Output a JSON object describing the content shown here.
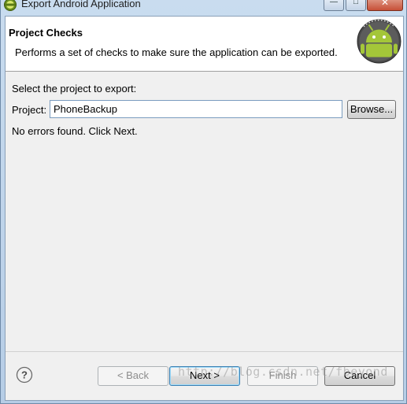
{
  "window": {
    "title": "Export Android Application",
    "app_icon": "eclipse-icon",
    "controls": [
      "minimize-icon",
      "maximize-icon",
      "close-icon"
    ]
  },
  "banner": {
    "title": "Project Checks",
    "description": "Performs a set of checks to make sure the application can be exported.",
    "logo": "android-logo"
  },
  "form": {
    "select_label": "Select the project to export:",
    "project_label": "Project:",
    "project_value": "PhoneBackup",
    "browse_label": "Browse...",
    "status": "No errors found. Click Next."
  },
  "footer": {
    "help_icon": "help-icon",
    "back_label": "< Back",
    "next_label": "Next >",
    "finish_label": "Finish",
    "cancel_label": "Cancel"
  },
  "watermark": "http://blog.csdn.net/fbeyond",
  "colors": {
    "title_bar": "#c9dcef",
    "banner_bg": "#ffffff",
    "dialog_bg": "#f0f0f0",
    "android_green": "#a4c639"
  }
}
